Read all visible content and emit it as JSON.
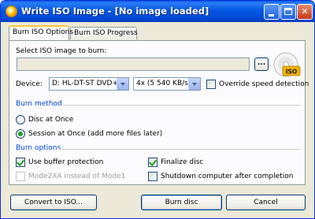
{
  "window": {
    "title": "Write ISO Image - [No image loaded]"
  },
  "tabs": [
    {
      "label": "Burn ISO Options",
      "active": true
    },
    {
      "label": "Burn ISO Progress",
      "active": false
    }
  ],
  "image": {
    "label": "Select ISO image to burn:",
    "value": "",
    "browse_label": "...",
    "logo_text": "ISO"
  },
  "device": {
    "label": "Device:",
    "drive_value": "D: HL-DT-ST DVD+-R'",
    "speed_value": "4x (5 540 KB/s)",
    "override_label": "Override speed detection",
    "override_checked": false
  },
  "burn_method": {
    "title": "Burn method",
    "options": [
      {
        "label": "Disc at Once",
        "selected": false
      },
      {
        "label": "Session at Once (add more files later)",
        "selected": true
      }
    ]
  },
  "burn_options": {
    "title": "Burn options",
    "buffer_protection": {
      "label": "Use buffer protection",
      "checked": true
    },
    "finalize_disc": {
      "label": "Finalize disc",
      "checked": true
    },
    "mode2": {
      "label": "Mode2XA instead of Mode1",
      "checked": false,
      "enabled": false
    },
    "shutdown": {
      "label": "Shutdown computer after completion",
      "checked": false
    }
  },
  "buttons": {
    "convert": "Convert to ISO...",
    "burn": "Burn disc",
    "cancel": "Cancel"
  }
}
